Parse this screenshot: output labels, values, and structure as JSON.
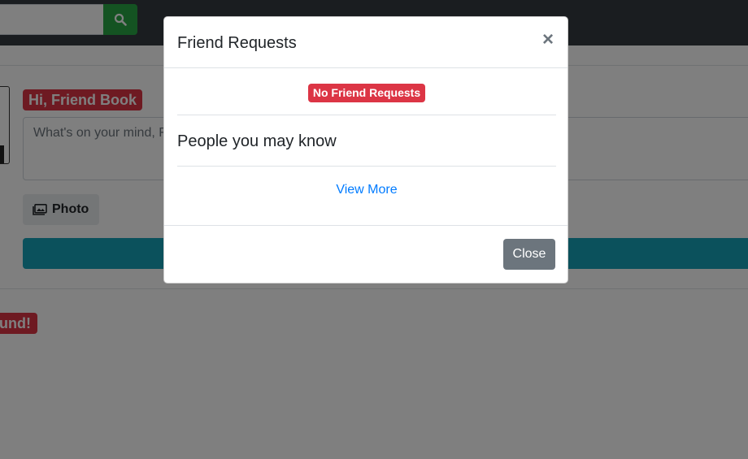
{
  "background": {
    "greeting": "Hi, Friend Book",
    "post_placeholder": "What's on your mind, F",
    "photo_label": "Photo",
    "not_found_label": "und!"
  },
  "modal": {
    "title": "Friend Requests",
    "close_symbol": "×",
    "badge": "No Friend Requests",
    "people_heading": "People you may know",
    "view_more": "View More",
    "close_button": "Close"
  },
  "colors": {
    "navbar": "#343a40",
    "danger": "#dc3545",
    "success": "#28a745",
    "info": "#17a2b8",
    "secondary": "#6c757d",
    "link": "#007bff"
  },
  "icons": {
    "search": "search-icon",
    "photo": "image-icon"
  }
}
